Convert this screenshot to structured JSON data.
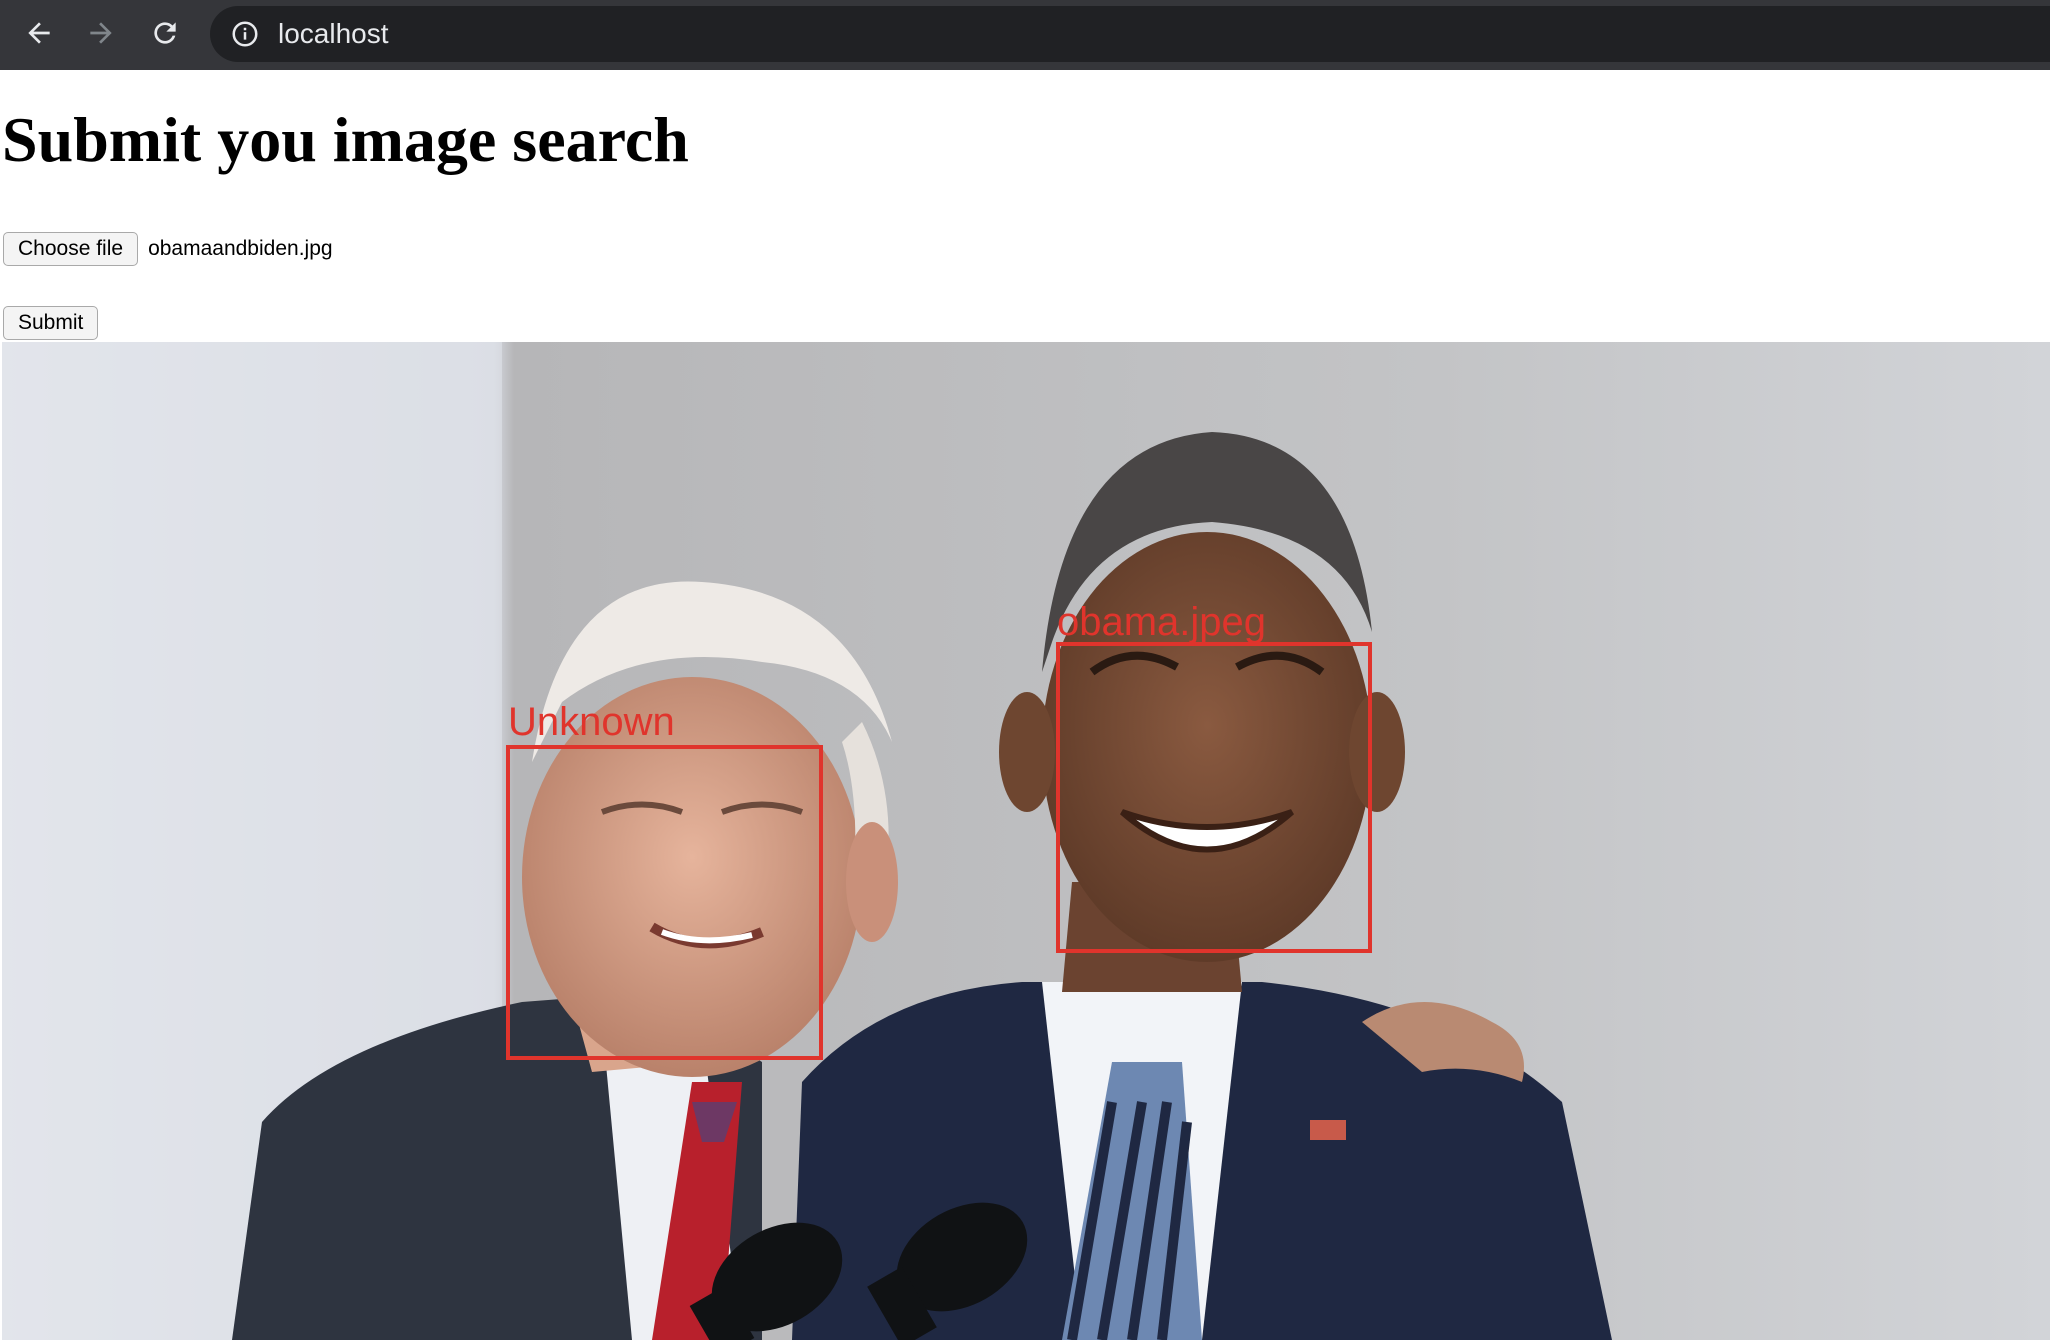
{
  "browser": {
    "url": "localhost",
    "icons": {
      "back": "back-arrow-icon",
      "forward": "forward-arrow-icon",
      "reload": "reload-icon",
      "site_info": "info-icon"
    }
  },
  "page": {
    "title": "Submit you image search",
    "file_input": {
      "button_label": "Choose file",
      "selected_file": "obamaandbiden.jpg"
    },
    "submit_label": "Submit"
  },
  "result_image": {
    "faces": [
      {
        "label": "Unknown"
      },
      {
        "label": "obama.jpeg"
      }
    ],
    "box_color": "#e0342c"
  }
}
